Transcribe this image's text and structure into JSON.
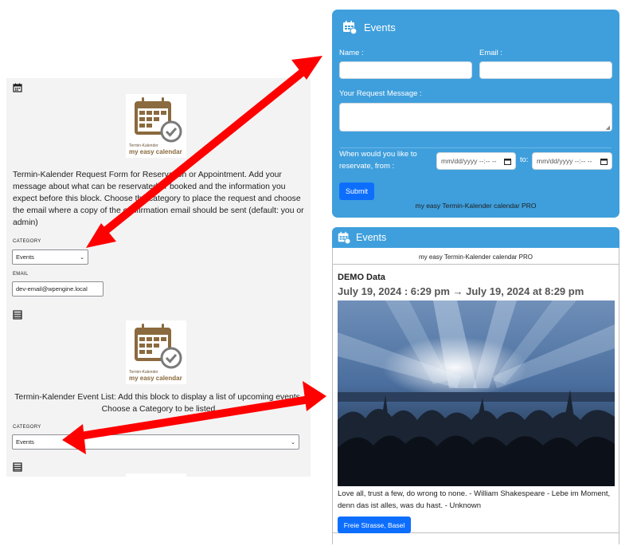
{
  "editor": {
    "request_description": "Termin-Kalender Request Form for Reservation or Appointment. Add your message about what can be reservated or booked and the information you expect before this block. Choose the category to place the request and choose the email where a copy of the confirmation email should be sent (default: you or admin)",
    "category_label": "CATEGORY",
    "category_value": "Events",
    "email_label": "EMAIL",
    "email_value": "dev-email@wpengine.local",
    "list_description": "Termin-Kalender Event List: Add this block to display a list of upcoming events. Choose a Category to be listed",
    "category2_label": "CATEGORY",
    "category2_value": "Events",
    "logo_line1": "Termin-Kalender",
    "logo_line2": "my easy calendar"
  },
  "request_form": {
    "title": "Events",
    "name_label": "Name :",
    "email_label": "Email :",
    "message_label": "Your Request Message :",
    "date_question": "When would you like to reservate, from :",
    "date_from_placeholder": "mm/dd/yyyy --:-- --",
    "to_label": "to:",
    "date_to_placeholder": "mm/dd/yyyy --:-- --",
    "submit_label": "Submit",
    "footer": "my easy Termin-Kalender calendar PRO"
  },
  "event_list": {
    "title": "Events",
    "footer": "my easy Termin-Kalender calendar PRO",
    "event_title": "DEMO Data",
    "event_date": "July 19, 2024 : 6:29 pm → July 19, 2024 at 8:29 pm",
    "event_text": "Love all, trust a few, do wrong to none. - William Shakespeare - Lebe im Moment, denn das ist alles, was du hast. - Unknown",
    "location_button": "Freie Strasse, Basel"
  },
  "colors": {
    "accent_blue": "#3f9fdc",
    "button_blue": "#0d6efd",
    "arrow_red": "#ff0000",
    "logo_brown": "#8a6a3e"
  }
}
